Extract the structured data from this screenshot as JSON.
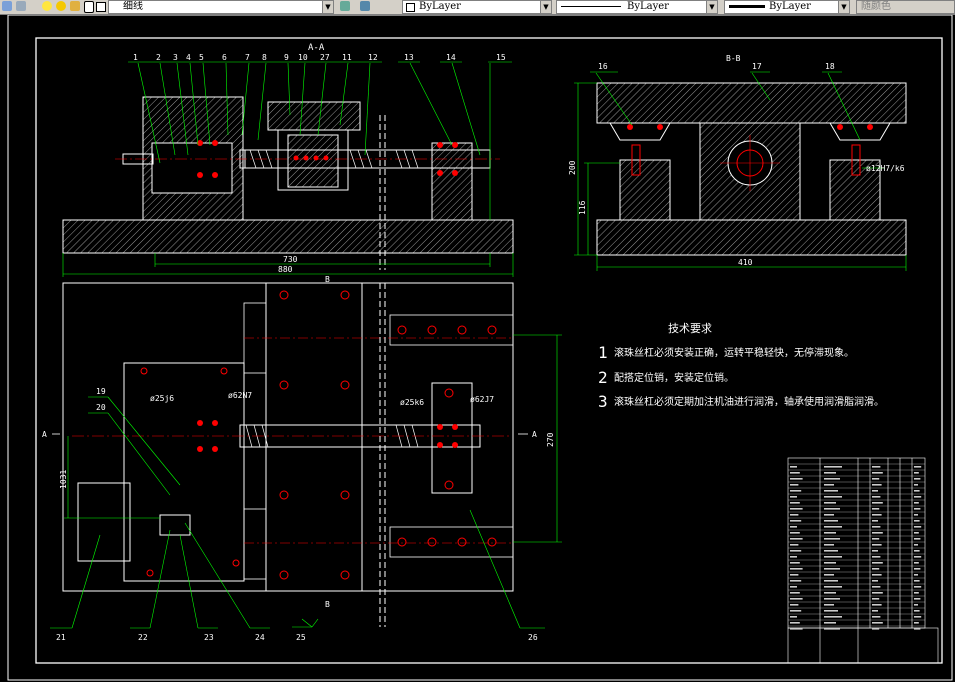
{
  "toolbar": {
    "layer_name": "细线",
    "color_value": "ByLayer",
    "linetype_value": "ByLayer",
    "lineweight_value": "ByLayer",
    "plotstyle_value": "随颜色",
    "icons": [
      "layer-manager-icon",
      "bulb-icon",
      "sun-icon",
      "lock-icon",
      "color-swatch-icon",
      "layer-previous-icon",
      "layer-states-icon"
    ]
  },
  "drawing": {
    "section_aa": "A-A",
    "section_bb": "B-B",
    "balloons_top": [
      "1",
      "2",
      "3",
      "4",
      "5",
      "6",
      "7",
      "8",
      "9",
      "10",
      "27",
      "11",
      "12",
      "13",
      "14",
      "15"
    ],
    "balloons_right": [
      "16",
      "17",
      "18"
    ],
    "balloons_plan_left": [
      "19",
      "20"
    ],
    "balloons_bottom": [
      "21",
      "22",
      "23",
      "24",
      "25",
      "26"
    ],
    "dims": {
      "d730": "730",
      "d880": "880",
      "d200": "200",
      "d116": "116",
      "d410": "410",
      "d270": "270",
      "d1031": "1031",
      "fit_12": "ø12H7/k6",
      "fit_25a": "ø25j6",
      "fit_62a": "ø62N7",
      "fit_25b": "ø25k6",
      "fit_62b": "ø62J7"
    },
    "cut_a": "A",
    "cut_b": "B",
    "colors": {
      "background": "#000000",
      "outline": "#ffffff",
      "dimension": "#00ff00",
      "center": "#ff0000",
      "hatch": "#ffffff",
      "hole": "#ff0000"
    }
  },
  "requirements": {
    "title": "技术要求",
    "items": [
      {
        "num": "1",
        "text": "滚珠丝杠必须安装正确，运转平稳轻快，无停滞现象。"
      },
      {
        "num": "2",
        "text": "配搭定位销，安装定位销。"
      },
      {
        "num": "3",
        "text": "滚珠丝杠必须定期加注机油进行润滑，轴承使用润滑脂润滑。"
      }
    ]
  }
}
